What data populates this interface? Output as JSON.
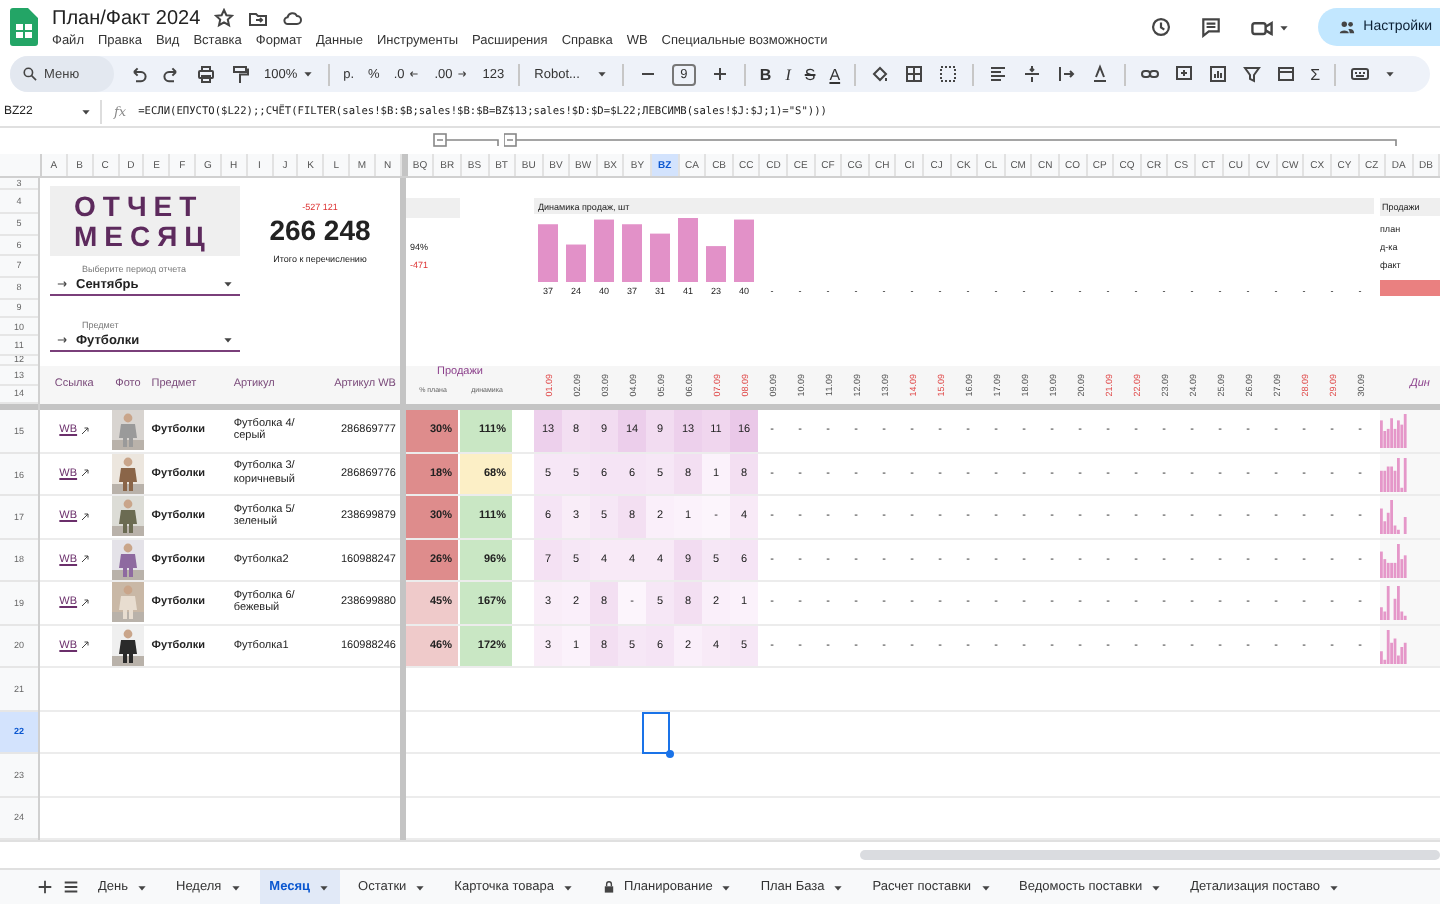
{
  "app": {
    "title": "План/Факт 2024",
    "share_button": "Настройки"
  },
  "menu": [
    "Файл",
    "Правка",
    "Вид",
    "Вставка",
    "Формат",
    "Данные",
    "Инструменты",
    "Расширения",
    "Справка",
    "WB",
    "Специальные возможности"
  ],
  "toolbar": {
    "search": {
      "placeholder": "Меню"
    },
    "zoom": "100%",
    "currency": "р.",
    "percent": "%",
    "decrease_decimals": ".0",
    "increase_decimals": ".00",
    "number_format": "123",
    "font": "Robot...",
    "font_size": "9",
    "bold": "B",
    "italic": "I",
    "strikethrough": "S",
    "text_color": "A",
    "sum": "Σ"
  },
  "formula_bar": {
    "cell": "BZ22",
    "fx": "fx",
    "formula": "=ЕСЛИ(ЕПУСТО($L22);;СЧЁТ(FILTER(sales!$B:$B;sales!$B:$B=BZ$13;sales!$D:$D=$L22;ЛЕВСИМВ(sales!$J:$J;1)=\"S\")))"
  },
  "columns_left": [
    {
      "label": "A",
      "selected": false
    },
    {
      "label": "B",
      "selected": false
    },
    {
      "label": "C",
      "selected": false
    },
    {
      "label": "D",
      "selected": false
    },
    {
      "label": "E",
      "selected": false
    },
    {
      "label": "F",
      "selected": false
    },
    {
      "label": "G",
      "selected": false
    },
    {
      "label": "H",
      "selected": false
    },
    {
      "label": "I",
      "selected": false
    },
    {
      "label": "J",
      "selected": false
    },
    {
      "label": "K",
      "selected": false
    },
    {
      "label": "L",
      "selected": false
    },
    {
      "label": "M",
      "selected": false
    },
    {
      "label": "N",
      "selected": false
    }
  ],
  "columns_right": [
    {
      "label": "BQ",
      "selected": false
    },
    {
      "label": "BR",
      "selected": false
    },
    {
      "label": "BS",
      "selected": false
    },
    {
      "label": "BT",
      "selected": false
    },
    {
      "label": "BU",
      "selected": false
    },
    {
      "label": "BV",
      "selected": false
    },
    {
      "label": "BW",
      "selected": false
    },
    {
      "label": "BX",
      "selected": false
    },
    {
      "label": "BY",
      "selected": false
    },
    {
      "label": "BZ",
      "selected": true
    },
    {
      "label": "CA",
      "selected": false
    },
    {
      "label": "CB",
      "selected": false
    },
    {
      "label": "CC",
      "selected": false
    },
    {
      "label": "CD",
      "selected": false
    },
    {
      "label": "CE",
      "selected": false
    },
    {
      "label": "CF",
      "selected": false
    },
    {
      "label": "CG",
      "selected": false
    },
    {
      "label": "CH",
      "selected": false
    },
    {
      "label": "CI",
      "selected": false
    },
    {
      "label": "CJ",
      "selected": false
    },
    {
      "label": "CK",
      "selected": false
    },
    {
      "label": "CL",
      "selected": false
    },
    {
      "label": "CM",
      "selected": false
    },
    {
      "label": "CN",
      "selected": false
    },
    {
      "label": "CO",
      "selected": false
    },
    {
      "label": "CP",
      "selected": false
    },
    {
      "label": "CQ",
      "selected": false
    },
    {
      "label": "CR",
      "selected": false
    },
    {
      "label": "CS",
      "selected": false
    },
    {
      "label": "CT",
      "selected": false
    },
    {
      "label": "CU",
      "selected": false
    },
    {
      "label": "CV",
      "selected": false
    },
    {
      "label": "CW",
      "selected": false
    },
    {
      "label": "CX",
      "selected": false
    },
    {
      "label": "CY",
      "selected": false
    },
    {
      "label": "CZ",
      "selected": false
    },
    {
      "label": "DA",
      "selected": false
    },
    {
      "label": "DB",
      "selected": false
    }
  ],
  "rows": [
    {
      "label": "3",
      "selected": false
    },
    {
      "label": "4",
      "selected": false
    },
    {
      "label": "5",
      "selected": false
    },
    {
      "label": "6",
      "selected": false
    },
    {
      "label": "7",
      "selected": false
    },
    {
      "label": "8",
      "selected": false
    },
    {
      "label": "9",
      "selected": false
    },
    {
      "label": "10",
      "selected": false
    },
    {
      "label": "11",
      "selected": false
    },
    {
      "label": "12",
      "selected": false
    },
    {
      "label": "13",
      "selected": false
    },
    {
      "label": "14",
      "selected": false
    },
    {
      "label": "15",
      "selected": false
    },
    {
      "label": "16",
      "selected": false
    },
    {
      "label": "17",
      "selected": false
    },
    {
      "label": "18",
      "selected": false
    },
    {
      "label": "19",
      "selected": false
    },
    {
      "label": "20",
      "selected": false
    },
    {
      "label": "21",
      "selected": false
    },
    {
      "label": "22",
      "selected": true
    },
    {
      "label": "23",
      "selected": false
    },
    {
      "label": "24",
      "selected": false
    }
  ],
  "report": {
    "title_lines": [
      "ОТЧЕТ",
      "МЕСЯЦ"
    ],
    "total_delta": "-527 121",
    "total": "266 248",
    "total_label": "Итого к перечислению",
    "period": {
      "label": "Выберите период отчета",
      "value": "Сентябрь"
    },
    "subject": {
      "label": "Предмет",
      "value": "Футболки"
    }
  },
  "summary": {
    "percent": "94%",
    "delta": "-471"
  },
  "chart": {
    "title": "Динамика продаж, шт",
    "labels": [
      "37",
      "24",
      "40",
      "37",
      "31",
      "41",
      "23",
      "40",
      "-",
      "-",
      "-",
      "-",
      "-",
      "-",
      "-",
      "-",
      "-",
      "-",
      "-",
      "-",
      "-",
      "-",
      "-",
      "-",
      "-",
      "-",
      "-",
      "-",
      "-",
      "-"
    ]
  },
  "legend": {
    "title": "Продажи",
    "items": [
      "план",
      "д-ка",
      "факт"
    ]
  },
  "table": {
    "columns": [
      "Ссылка",
      "Фото",
      "Предмет",
      "Артикул",
      "Артикул WB"
    ],
    "sales_title": "Продажи",
    "sales_columns": [
      "% плана",
      "динамика"
    ],
    "trend_title": "Дин",
    "dates": [
      {
        "label": "01.09",
        "weekend": true
      },
      {
        "label": "02.09",
        "weekend": false
      },
      {
        "label": "03.09",
        "weekend": false
      },
      {
        "label": "04.09",
        "weekend": false
      },
      {
        "label": "05.09",
        "weekend": false
      },
      {
        "label": "06.09",
        "weekend": false
      },
      {
        "label": "07.09",
        "weekend": true
      },
      {
        "label": "08.09",
        "weekend": true
      },
      {
        "label": "09.09",
        "weekend": false
      },
      {
        "label": "10.09",
        "weekend": false
      },
      {
        "label": "11.09",
        "weekend": false
      },
      {
        "label": "12.09",
        "weekend": false
      },
      {
        "label": "13.09",
        "weekend": false
      },
      {
        "label": "14.09",
        "weekend": true
      },
      {
        "label": "15.09",
        "weekend": true
      },
      {
        "label": "16.09",
        "weekend": false
      },
      {
        "label": "17.09",
        "weekend": false
      },
      {
        "label": "18.09",
        "weekend": false
      },
      {
        "label": "19.09",
        "weekend": false
      },
      {
        "label": "20.09",
        "weekend": false
      },
      {
        "label": "21.09",
        "weekend": true
      },
      {
        "label": "22.09",
        "weekend": true
      },
      {
        "label": "23.09",
        "weekend": false
      },
      {
        "label": "24.09",
        "weekend": false
      },
      {
        "label": "25.09",
        "weekend": false
      },
      {
        "label": "26.09",
        "weekend": false
      },
      {
        "label": "27.09",
        "weekend": false
      },
      {
        "label": "28.09",
        "weekend": true
      },
      {
        "label": "29.09",
        "weekend": true
      },
      {
        "label": "30.09",
        "weekend": false
      }
    ],
    "rows": [
      {
        "link": "WB",
        "subject": "Футболки",
        "article": "Футболка 4/серый",
        "wb_article": "286869777",
        "plan": "30%",
        "dynamics": "111%",
        "days": [
          "13",
          "8",
          "9",
          "14",
          "9",
          "13",
          "11",
          "16",
          "-",
          "-",
          "-",
          "-",
          "-",
          "-",
          "-",
          "-",
          "-",
          "-",
          "-",
          "-",
          "-",
          "-",
          "-",
          "-",
          "-",
          "-",
          "-",
          "-",
          "-",
          "-"
        ]
      },
      {
        "link": "WB",
        "subject": "Футболки",
        "article": "Футболка 3/коричневый",
        "wb_article": "286869776",
        "plan": "18%",
        "dynamics": "68%",
        "days": [
          "5",
          "5",
          "6",
          "6",
          "5",
          "8",
          "1",
          "8",
          "-",
          "-",
          "-",
          "-",
          "-",
          "-",
          "-",
          "-",
          "-",
          "-",
          "-",
          "-",
          "-",
          "-",
          "-",
          "-",
          "-",
          "-",
          "-",
          "-",
          "-",
          "-"
        ]
      },
      {
        "link": "WB",
        "subject": "Футболки",
        "article": "Футболка 5/ зеленый",
        "wb_article": "238699879",
        "plan": "30%",
        "dynamics": "111%",
        "days": [
          "6",
          "3",
          "5",
          "8",
          "2",
          "1",
          "-",
          "4",
          "-",
          "-",
          "-",
          "-",
          "-",
          "-",
          "-",
          "-",
          "-",
          "-",
          "-",
          "-",
          "-",
          "-",
          "-",
          "-",
          "-",
          "-",
          "-",
          "-",
          "-",
          "-"
        ]
      },
      {
        "link": "WB",
        "subject": "Футболки",
        "article": "Футболка2",
        "wb_article": "160988247",
        "plan": "26%",
        "dynamics": "96%",
        "days": [
          "7",
          "5",
          "4",
          "4",
          "4",
          "9",
          "5",
          "6",
          "-",
          "-",
          "-",
          "-",
          "-",
          "-",
          "-",
          "-",
          "-",
          "-",
          "-",
          "-",
          "-",
          "-",
          "-",
          "-",
          "-",
          "-",
          "-",
          "-",
          "-",
          "-"
        ]
      },
      {
        "link": "WB",
        "subject": "Футболки",
        "article": "Футболка 6/ бежевый",
        "wb_article": "238699880",
        "plan": "45%",
        "dynamics": "167%",
        "days": [
          "3",
          "2",
          "8",
          "-",
          "5",
          "8",
          "2",
          "1",
          "-",
          "-",
          "-",
          "-",
          "-",
          "-",
          "-",
          "-",
          "-",
          "-",
          "-",
          "-",
          "-",
          "-",
          "-",
          "-",
          "-",
          "-",
          "-",
          "-",
          "-",
          "-"
        ]
      },
      {
        "link": "WB",
        "subject": "Футболки",
        "article": "Футболка1",
        "wb_article": "160988246",
        "plan": "46%",
        "dynamics": "172%",
        "days": [
          "3",
          "1",
          "8",
          "5",
          "6",
          "2",
          "4",
          "5",
          "-",
          "-",
          "-",
          "-",
          "-",
          "-",
          "-",
          "-",
          "-",
          "-",
          "-",
          "-",
          "-",
          "-",
          "-",
          "-",
          "-",
          "-",
          "-",
          "-",
          "-",
          "-"
        ]
      }
    ]
  },
  "tabs": [
    {
      "label": "День",
      "selected": false,
      "locked": false
    },
    {
      "label": "Неделя",
      "selected": false,
      "locked": false
    },
    {
      "label": "Месяц",
      "selected": true,
      "locked": false
    },
    {
      "label": "Остатки",
      "selected": false,
      "locked": false
    },
    {
      "label": "Карточка товара",
      "selected": false,
      "locked": false
    },
    {
      "label": "Планирование",
      "selected": false,
      "locked": true
    },
    {
      "label": "План База",
      "selected": false,
      "locked": false
    },
    {
      "label": "Расчет поставки",
      "selected": false,
      "locked": false
    },
    {
      "label": "Ведомость поставки",
      "selected": false,
      "locked": false
    },
    {
      "label": "Детализация поставо",
      "selected": false,
      "locked": false
    }
  ]
}
